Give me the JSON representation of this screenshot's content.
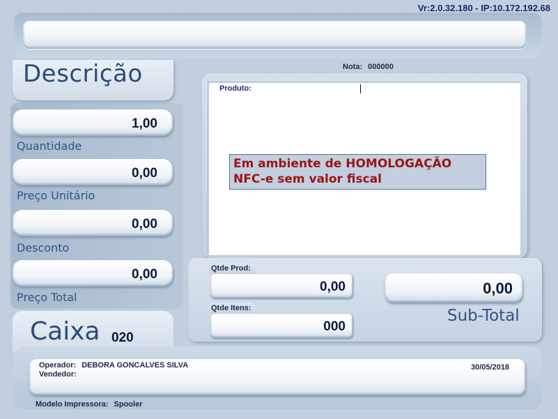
{
  "header": {
    "version": "Vr:2.0.32.180 - IP:10.172.192.68",
    "top_bar_value": ""
  },
  "description": {
    "title": "Descrição"
  },
  "fields": {
    "quantidade": {
      "label": "Quantidade",
      "value": "1,00"
    },
    "preco_unitario": {
      "label": "Preço Unitário",
      "value": "0,00"
    },
    "desconto": {
      "label": "Desconto",
      "value": "0,00"
    },
    "preco_total": {
      "label": "Preço Total",
      "value": "0,00"
    }
  },
  "caixa": {
    "title": "Caixa",
    "number": "020"
  },
  "nota": {
    "label": "Nota:",
    "value": "000000"
  },
  "produto": {
    "label": "Produto:",
    "value": ""
  },
  "homologation_notice": {
    "line1": "Em ambiente de HOMOLOGAÇÃO",
    "line2": "NFC-e sem valor fiscal"
  },
  "summary": {
    "qtde_prod_label": "Qtde Prod:",
    "qtde_prod_value": "0,00",
    "qtde_itens_label": "Qtde Itens:",
    "qtde_itens_value": "000",
    "subtotal_value": "0,00",
    "subtotal_label": "Sub-Total"
  },
  "footer": {
    "operador_label": "Operador:",
    "operador_value": "DEBORA GONCALVES SILVA",
    "vendedor_label": "Vendedor:",
    "vendedor_value": "",
    "date": "30/05/2018",
    "impressora_label": "Modelo Impressora:",
    "impressora_value": "Spooler"
  },
  "colors": {
    "background": "#c3cfde",
    "label_blue": "#2f5585",
    "warning_red": "#9a1515"
  }
}
